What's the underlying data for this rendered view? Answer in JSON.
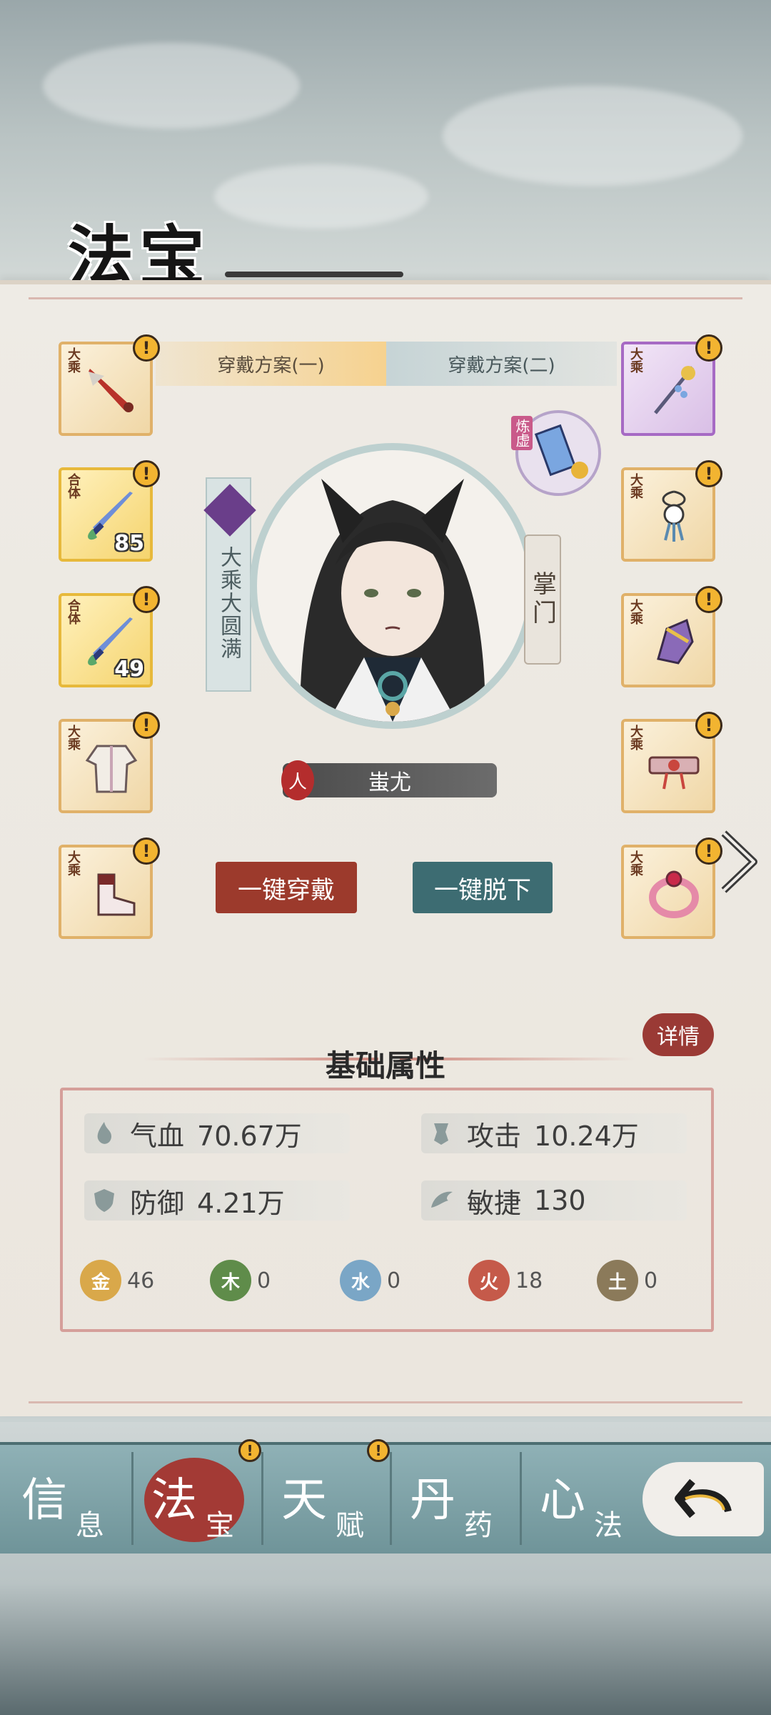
{
  "title": "法宝",
  "plan_tabs": [
    {
      "label": "穿戴方案(一)",
      "active": true
    },
    {
      "label": "穿戴方案(二)",
      "active": false
    }
  ],
  "left_slots": [
    {
      "grade": "大乘",
      "item": "dagger-icon",
      "alert": "!"
    },
    {
      "grade": "合体",
      "item": "sword-icon",
      "level": "85",
      "alert": "!"
    },
    {
      "grade": "合体",
      "item": "sword-icon",
      "level": "49",
      "alert": "!"
    },
    {
      "grade": "大乘",
      "item": "robe-icon",
      "alert": "!"
    },
    {
      "grade": "大乘",
      "item": "boots-icon",
      "alert": "!"
    }
  ],
  "right_slots": [
    {
      "grade": "大乘",
      "item": "hairpin-icon",
      "alert": "!"
    },
    {
      "grade": "大乘",
      "item": "pendant-icon",
      "alert": "!"
    },
    {
      "grade": "大乘",
      "item": "gauntlet-icon",
      "alert": "!"
    },
    {
      "grade": "大乘",
      "item": "belt-icon",
      "alert": "!"
    },
    {
      "grade": "大乘",
      "item": "ring-icon",
      "alert": "!"
    }
  ],
  "refine_badge": "炼虚",
  "character": {
    "realm": "大乘大圆满",
    "role": "掌门",
    "race": "人",
    "name": "蚩尤"
  },
  "buttons": {
    "equip_all": "一键穿戴",
    "unequip_all": "一键脱下"
  },
  "attributes": {
    "title": "基础属性",
    "detail": "详情",
    "stats": [
      {
        "label": "气血",
        "value": "70.67万",
        "icon": "blood-icon"
      },
      {
        "label": "攻击",
        "value": "10.24万",
        "icon": "attack-icon"
      },
      {
        "label": "防御",
        "value": "4.21万",
        "icon": "shield-icon"
      },
      {
        "label": "敏捷",
        "value": "130",
        "icon": "wing-icon"
      }
    ],
    "elements": [
      {
        "glyph": "金",
        "value": "46",
        "color": "#d9a84a"
      },
      {
        "glyph": "木",
        "value": "0",
        "color": "#5f8c4a"
      },
      {
        "glyph": "水",
        "value": "0",
        "color": "#7aa6c6"
      },
      {
        "glyph": "火",
        "value": "18",
        "color": "#c55a4a"
      },
      {
        "glyph": "土",
        "value": "0",
        "color": "#8b7a5a"
      }
    ]
  },
  "nav": [
    {
      "big": "信",
      "small": "息",
      "active": false
    },
    {
      "big": "法",
      "small": "宝",
      "active": true,
      "alert": "!"
    },
    {
      "big": "天",
      "small": "赋",
      "active": false,
      "alert": "!"
    },
    {
      "big": "丹",
      "small": "药",
      "active": false
    },
    {
      "big": "心",
      "small": "法",
      "active": false
    }
  ],
  "colors": {
    "accent_red": "#9c3a2c",
    "accent_teal": "#3d6c72",
    "slot_gold": "#e0b169",
    "slot_purple": "#a66ac4"
  }
}
